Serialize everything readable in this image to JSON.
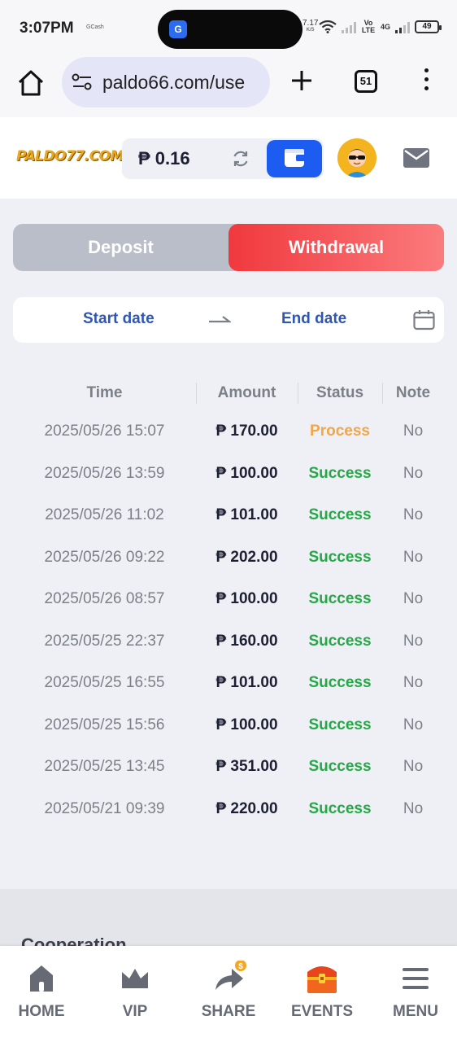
{
  "status_bar": {
    "time": "3:07PM",
    "notification": "GCash",
    "net_speed_value": "7.17",
    "net_speed_unit": "K/S",
    "network_1": "Vo LTE",
    "network_2": "4G",
    "battery": "49"
  },
  "browser": {
    "url": "paldo66.com/use",
    "tab_count": "51"
  },
  "header": {
    "logo_text": "PALDO77.COM",
    "balance": "₱ 0.16"
  },
  "tabs": {
    "deposit_label": "Deposit",
    "withdrawal_label": "Withdrawal",
    "active": "Withdrawal"
  },
  "date_range": {
    "start_label": "Start date",
    "end_label": "End date"
  },
  "table": {
    "headers": [
      "Time",
      "Amount",
      "Status",
      "Note"
    ],
    "rows": [
      {
        "time": "2025/05/26 15:07",
        "amount": "₱ 170.00",
        "status": "Process",
        "note": "No"
      },
      {
        "time": "2025/05/26 13:59",
        "amount": "₱ 100.00",
        "status": "Success",
        "note": "No"
      },
      {
        "time": "2025/05/26 11:02",
        "amount": "₱ 101.00",
        "status": "Success",
        "note": "No"
      },
      {
        "time": "2025/05/26 09:22",
        "amount": "₱ 202.00",
        "status": "Success",
        "note": "No"
      },
      {
        "time": "2025/05/26 08:57",
        "amount": "₱ 100.00",
        "status": "Success",
        "note": "No"
      },
      {
        "time": "2025/05/25 22:37",
        "amount": "₱ 160.00",
        "status": "Success",
        "note": "No"
      },
      {
        "time": "2025/05/25 16:55",
        "amount": "₱ 101.00",
        "status": "Success",
        "note": "No"
      },
      {
        "time": "2025/05/25 15:56",
        "amount": "₱ 100.00",
        "status": "Success",
        "note": "No"
      },
      {
        "time": "2025/05/25 13:45",
        "amount": "₱ 351.00",
        "status": "Success",
        "note": "No"
      },
      {
        "time": "2025/05/21 09:39",
        "amount": "₱ 220.00",
        "status": "Success",
        "note": "No"
      }
    ]
  },
  "status_colors": {
    "Process": "#f0a64a",
    "Success": "#26a846"
  },
  "footer": {
    "section_title": "Cooperation"
  },
  "bottom_nav": {
    "items": [
      {
        "label": "HOME",
        "icon": "home-icon"
      },
      {
        "label": "VIP",
        "icon": "crown-icon"
      },
      {
        "label": "SHARE",
        "icon": "share-arrow-icon"
      },
      {
        "label": "EVENTS",
        "icon": "treasure-chest-icon"
      },
      {
        "label": "MENU",
        "icon": "hamburger-menu-icon"
      }
    ]
  },
  "colors": {
    "accent_blue": "#1d5cf0",
    "withdrawal_red": "#f0393e",
    "link_blue": "#2f56b5"
  }
}
